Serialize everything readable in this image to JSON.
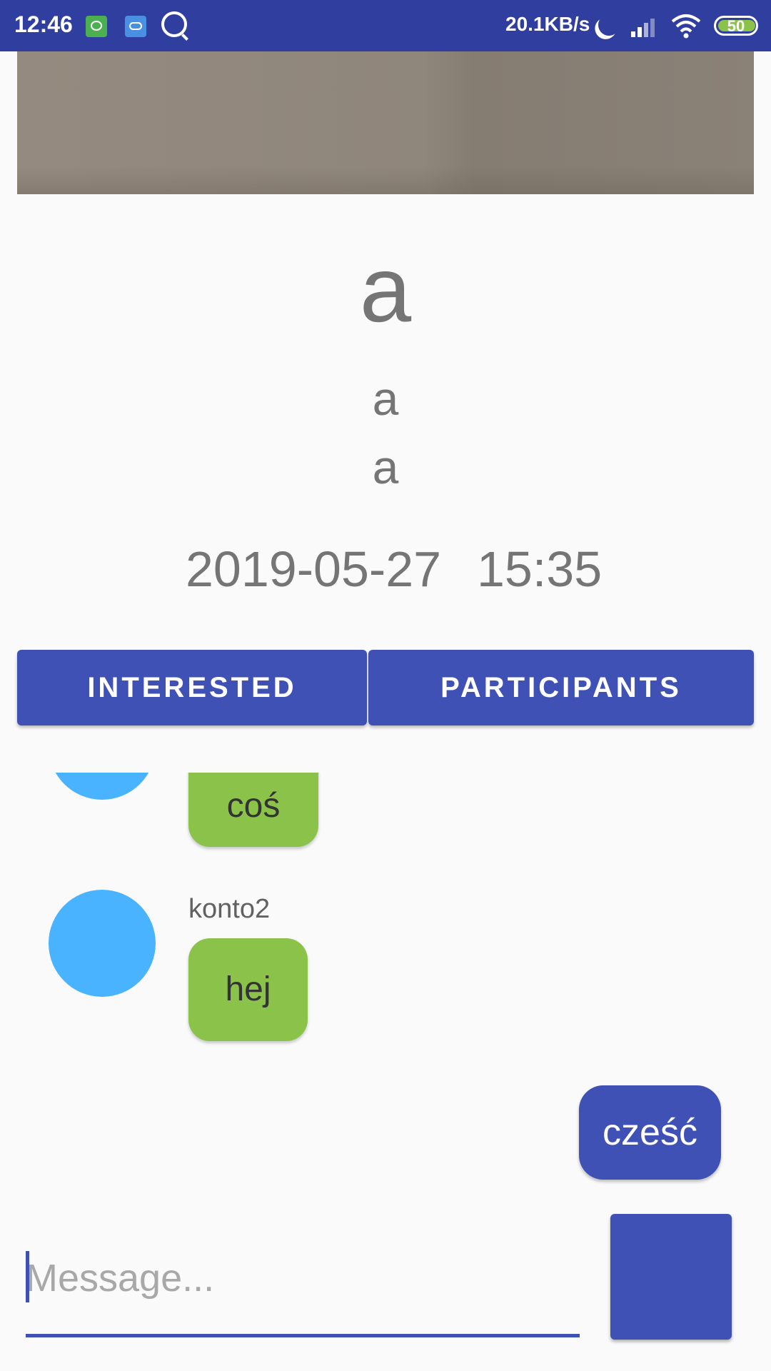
{
  "status_bar": {
    "time": "12:46",
    "network_speed": "20.1KB/s",
    "battery_level": "50",
    "icons": [
      "app-icon-green",
      "cloud-app-icon",
      "search-icon",
      "moon-icon",
      "signal-icon",
      "wifi-icon",
      "battery-icon"
    ]
  },
  "event": {
    "title": "a",
    "line1": "a",
    "line2": "a",
    "date": "2019-05-27",
    "time": "15:35"
  },
  "buttons": {
    "interested": "INTERESTED",
    "participants": "PARTICIPANTS"
  },
  "chat": {
    "messages": [
      {
        "direction": "incoming",
        "sender": "",
        "text": "coś"
      },
      {
        "direction": "incoming",
        "sender": "konto2",
        "text": "hej"
      },
      {
        "direction": "outgoing",
        "sender": "",
        "text": "cześć"
      }
    ]
  },
  "composer": {
    "placeholder": "Message...",
    "value": ""
  },
  "colors": {
    "primary": "#3f51b5",
    "status_bar": "#303f9f",
    "incoming_bubble": "#8bc34a",
    "avatar": "#4ab3ff",
    "background": "#fafafa"
  }
}
